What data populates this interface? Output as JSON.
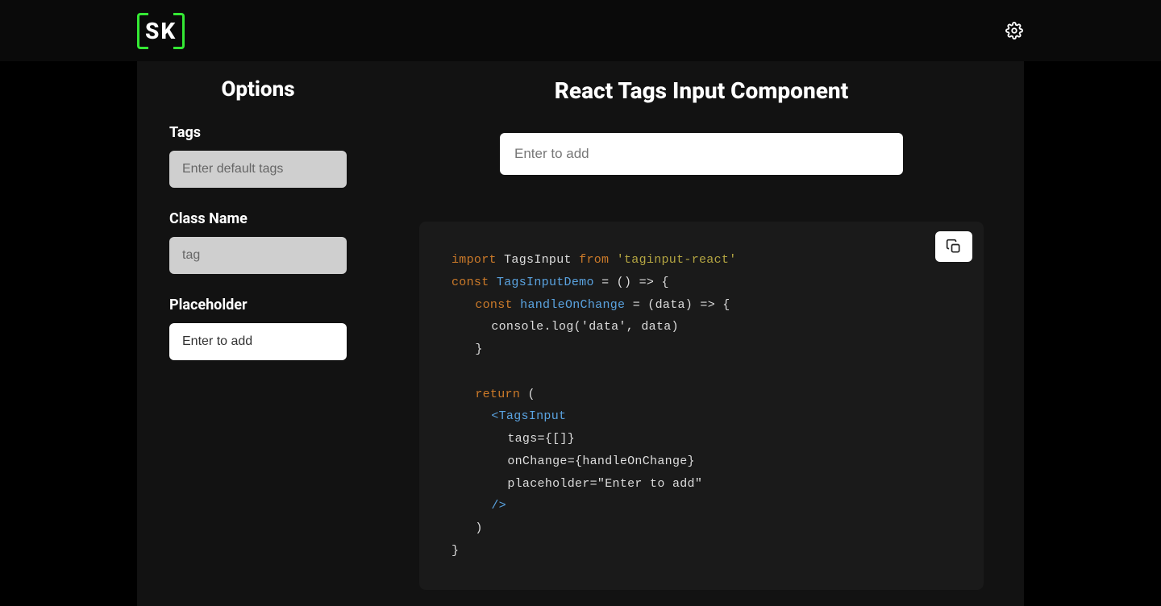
{
  "header": {
    "logo_text": "SK"
  },
  "sidebar": {
    "title": "Options",
    "fields": {
      "tags": {
        "label": "Tags",
        "placeholder": "Enter default tags",
        "value": ""
      },
      "class_name": {
        "label": "Class Name",
        "placeholder": "tag",
        "value": ""
      },
      "placeholder": {
        "label": "Placeholder",
        "placeholder": "",
        "value": "Enter to add"
      }
    }
  },
  "main": {
    "title": "React Tags Input Component",
    "enter_placeholder": "Enter to add"
  },
  "code": {
    "kw_import": "import",
    "id_tagsinput": "TagsInput",
    "kw_from": "from",
    "str_pkg": "'taginput-react'",
    "kw_const": "const",
    "id_demo": "TagsInputDemo",
    "arrow_open": " = () => {",
    "kw_const2": "const",
    "id_handle": "handleOnChange",
    "handle_arrow": " = (data) => {",
    "console_line": "console.log('data', data)",
    "close_brace": "}",
    "kw_return": "return",
    "return_open": " (",
    "jsx_open": "<",
    "jsx_tag": "TagsInput",
    "prop_tags": "tags={[]}",
    "prop_onchange": "onChange={handleOnChange}",
    "prop_placeholder": "placeholder=\"Enter to add\"",
    "jsx_close": "/>",
    "paren_close": ")",
    "final_brace": "}"
  }
}
